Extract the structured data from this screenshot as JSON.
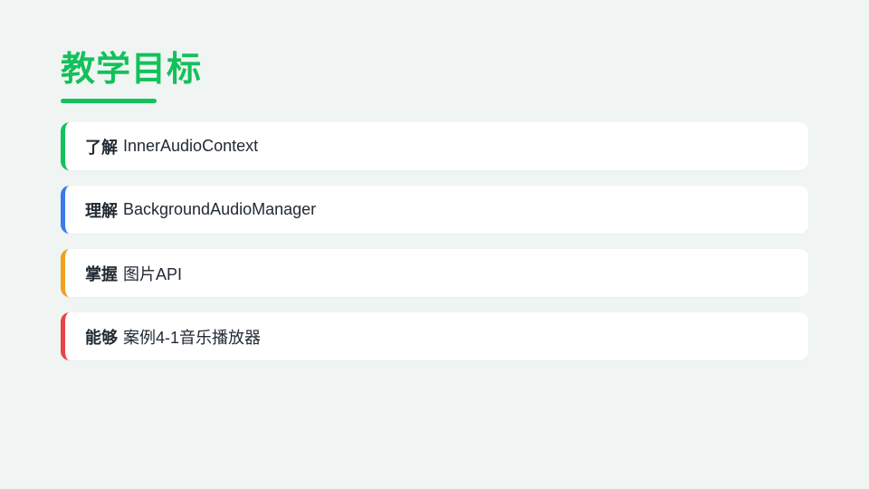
{
  "slide": {
    "title": "教学目标",
    "accent_color": "#13c15a",
    "goals": [
      {
        "verb": "了解",
        "text": "InnerAudioContext",
        "color": "#13c15a"
      },
      {
        "verb": "理解",
        "text": "BackgroundAudioManager",
        "color": "#3b7be6"
      },
      {
        "verb": "掌握",
        "text": "图片API",
        "color": "#f0a020"
      },
      {
        "verb": "能够",
        "text": "案例4-1音乐播放器",
        "color": "#e84545"
      }
    ]
  }
}
